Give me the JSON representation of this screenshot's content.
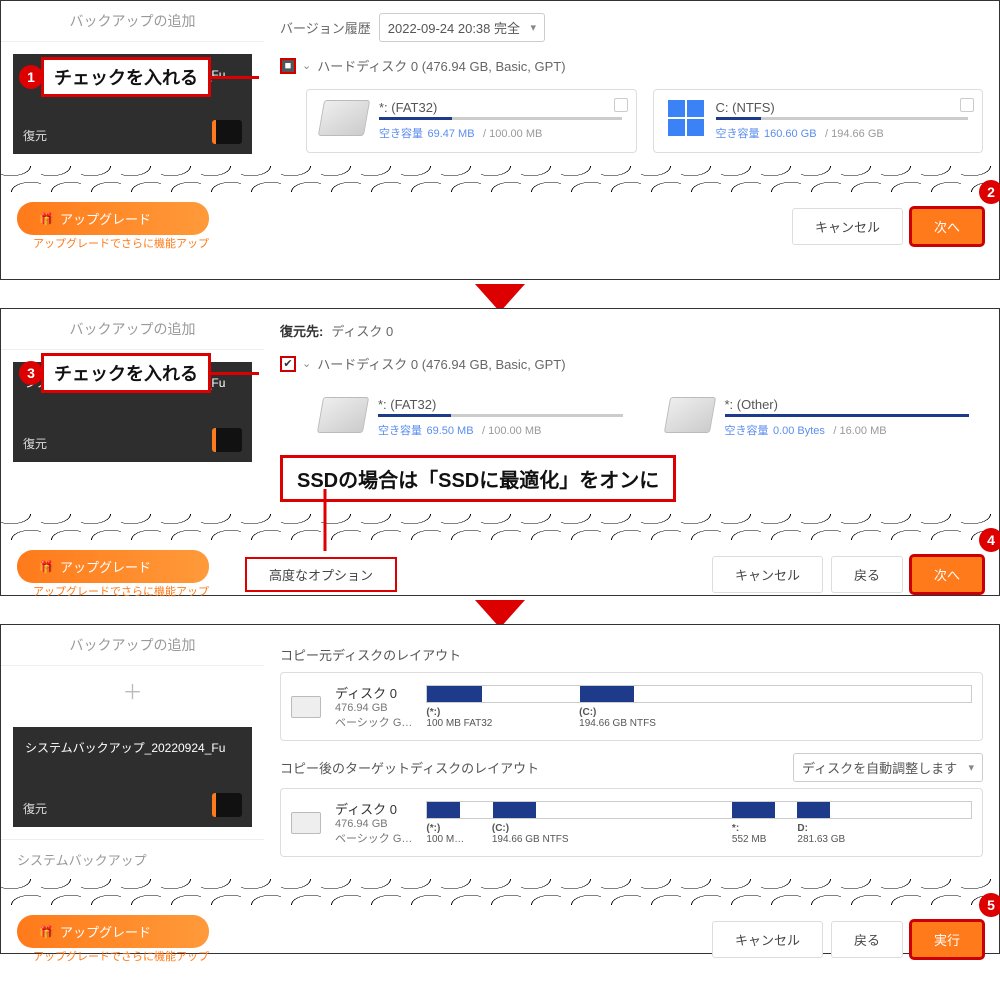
{
  "sidebar": {
    "add_tab": "バックアップの追加",
    "backup_title": "システムバックアップ_20220924_Fu",
    "restore_label": "復元",
    "system_backup": "システムバックアップ"
  },
  "panel1": {
    "version_label": "バージョン履歴",
    "version_value": "2022-09-24 20:38 完全",
    "disk_label": "ハードディスク 0 (476.94 GB, Basic, GPT)",
    "part_a": {
      "name": "*: (FAT32)",
      "free_label": "空き容量",
      "free": "69.47 MB",
      "total": "/ 100.00 MB"
    },
    "part_b": {
      "name": "C: (NTFS)",
      "free_label": "空き容量",
      "free": "160.60 GB",
      "total": "/ 194.66 GB"
    }
  },
  "panel2": {
    "dest_label": "復元先:",
    "dest_val": "ディスク 0",
    "disk_label": "ハードディスク 0 (476.94 GB, Basic, GPT)",
    "part_a": {
      "name": "*: (FAT32)",
      "free_label": "空き容量",
      "free": "69.50 MB",
      "total": "/ 100.00 MB"
    },
    "part_b": {
      "name": "*: (Other)",
      "free_label": "空き容量",
      "free": "0.00 Bytes",
      "total": "/ 16.00 MB"
    },
    "ssd_note": "SSDの場合は「SSDに最適化」をオンに",
    "adv_label": "高度なオプション"
  },
  "panel3": {
    "src_title": "コピー元ディスクのレイアウト",
    "tgt_title": "コピー後のターゲットディスクのレイアウト",
    "auto_adjust": "ディスクを自動調整します",
    "disk_name": "ディスク 0",
    "disk_size": "476.94 GB",
    "disk_type": "ベーシック G…",
    "src_parts": [
      {
        "name": "(*:)",
        "detail": "100 MB FAT32"
      },
      {
        "name": "(C:)",
        "detail": "194.66 GB NTFS"
      }
    ],
    "tgt_parts": [
      {
        "name": "(*:)",
        "detail": "100 M…"
      },
      {
        "name": "(C:)",
        "detail": "194.66 GB NTFS"
      },
      {
        "name": "*:",
        "detail": "552 MB"
      },
      {
        "name": "D:",
        "detail": "281.63 GB"
      }
    ]
  },
  "footer": {
    "upgrade": "アップグレード",
    "upgrade_note": "アップグレードでさらに機能アップ",
    "upgrade_note_cut": "アップグレードでさらに機能アップ",
    "cancel": "キャンセル",
    "back": "戻る",
    "next": "次へ",
    "run": "実行"
  },
  "callout": {
    "c1": "チェックを入れる",
    "c3": "チェックを入れる",
    "n1": "1",
    "n2": "2",
    "n3": "3",
    "n4": "4",
    "n5": "5"
  },
  "chart_data": {
    "type": "bar",
    "source_disk": {
      "name": "ディスク 0",
      "size_gb": 476.94,
      "style": "ベーシック GPT",
      "partitions": [
        {
          "label": "*:",
          "size": "100 MB",
          "fs": "FAT32"
        },
        {
          "label": "C:",
          "size": "194.66 GB",
          "fs": "NTFS"
        }
      ]
    },
    "target_disk": {
      "name": "ディスク 0",
      "size_gb": 476.94,
      "style": "ベーシック GPT",
      "partitions": [
        {
          "label": "*:",
          "size": "100 MB"
        },
        {
          "label": "C:",
          "size": "194.66 GB",
          "fs": "NTFS"
        },
        {
          "label": "*:",
          "size": "552 MB"
        },
        {
          "label": "D:",
          "size": "281.63 GB"
        }
      ]
    }
  }
}
